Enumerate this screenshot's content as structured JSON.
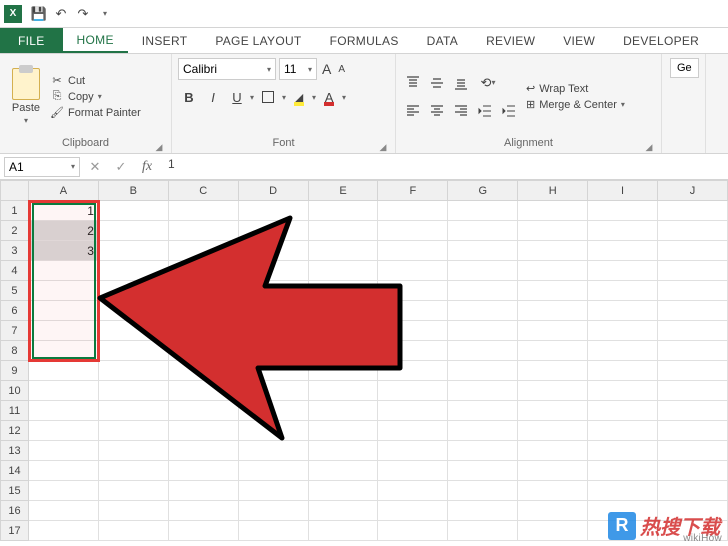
{
  "qat": {
    "save": "💾",
    "undo": "↶",
    "redo": "↷",
    "dd": "▾"
  },
  "tabs": {
    "file": "FILE",
    "items": [
      "HOME",
      "INSERT",
      "PAGE LAYOUT",
      "FORMULAS",
      "DATA",
      "REVIEW",
      "VIEW",
      "DEVELOPER"
    ],
    "active_index": 0
  },
  "ribbon": {
    "clipboard": {
      "label": "Clipboard",
      "paste": "Paste",
      "cut": "Cut",
      "copy": "Copy",
      "format_painter": "Format Painter"
    },
    "font": {
      "label": "Font",
      "name": "Calibri",
      "size": "11",
      "bold": "B",
      "italic": "I",
      "underline": "U",
      "grow": "A",
      "shrink": "A",
      "font_letter": "A",
      "bucket": "🪣"
    },
    "alignment": {
      "label": "Alignment",
      "wrap": "Wrap Text",
      "merge": "Merge & Center"
    },
    "trailing": {
      "label": "Ge"
    }
  },
  "formula_bar": {
    "name_box": "A1",
    "fx": "fx",
    "value": "1"
  },
  "columns": [
    "A",
    "B",
    "C",
    "D",
    "E",
    "F",
    "G",
    "H",
    "I",
    "J"
  ],
  "rows": [
    1,
    2,
    3,
    4,
    5,
    6,
    7,
    8,
    9,
    10,
    11,
    12,
    13,
    14,
    15,
    16,
    17
  ],
  "cells": {
    "A1": "1",
    "A2": "2",
    "A3": "3"
  },
  "selection": {
    "red_box": {
      "top_row": 1,
      "bottom_row": 8,
      "col": "A"
    },
    "green_box": {
      "top_row": 1,
      "bottom_row": 8,
      "col": "A"
    }
  },
  "watermark": {
    "r": "R",
    "text": "热搜下载",
    "wiki": "wikiHow"
  }
}
